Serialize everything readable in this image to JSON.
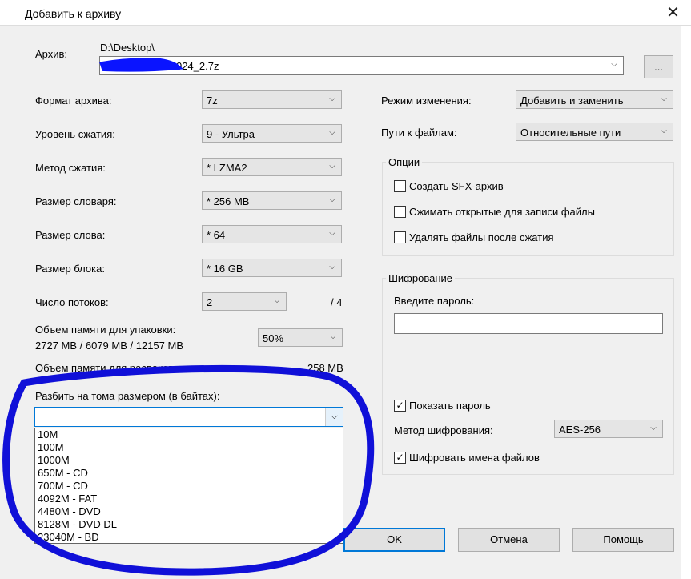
{
  "window": {
    "title": "Добавить к архиву",
    "close_glyph": "✕"
  },
  "archive": {
    "label": "Архив:",
    "path": "D:\\Desktop\\",
    "filename": "024_2.7z",
    "browse_label": "..."
  },
  "left": {
    "format_label": "Формат архива:",
    "format_value": "7z",
    "level_label": "Уровень сжатия:",
    "level_value": "9 - Ультра",
    "method_label": "Метод сжатия:",
    "method_value": "* LZMA2",
    "dict_label": "Размер словаря:",
    "dict_value": "* 256 MB",
    "word_label": "Размер слова:",
    "word_value": "* 64",
    "block_label": "Размер блока:",
    "block_value": "* 16 GB",
    "threads_label": "Число потоков:",
    "threads_value": "2",
    "threads_max": "/ 4",
    "mem_pack_label": "Объем памяти для упаковки:",
    "mem_pack_values": "2727 MB / 6079 MB / 12157 MB",
    "mem_pack_percent": "50%",
    "mem_unpack_label": "Объем памяти для распаковки:",
    "mem_unpack_value": "258 MB",
    "split_label": "Разбить на тома размером (в байтах):",
    "split_value": "",
    "split_options": [
      "10M",
      "100M",
      "1000M",
      "650M - CD",
      "700M - CD",
      "4092M - FAT",
      "4480M - DVD",
      "8128M - DVD DL",
      "23040M - BD"
    ]
  },
  "right": {
    "update_label": "Режим изменения:",
    "update_value": "Добавить и заменить",
    "paths_label": "Пути к файлам:",
    "paths_value": "Относительные пути",
    "options_title": "Опции",
    "opt_sfx": "Создать SFX-архив",
    "opt_shared": "Сжимать открытые для записи файлы",
    "opt_delete": "Удалять файлы после сжатия",
    "enc_title": "Шифрование",
    "enc_password_label": "Введите пароль:",
    "enc_show_password": "Показать пароль",
    "enc_method_label": "Метод шифрования:",
    "enc_method_value": "AES-256",
    "enc_names": "Шифровать имена файлов",
    "check_glyph": "✓"
  },
  "buttons": {
    "ok": "OK",
    "cancel": "Отмена",
    "help": "Помощь"
  },
  "colors": {
    "annotation": "#1010d8",
    "redaction": "#0a14ff",
    "focus": "#0078d7"
  }
}
